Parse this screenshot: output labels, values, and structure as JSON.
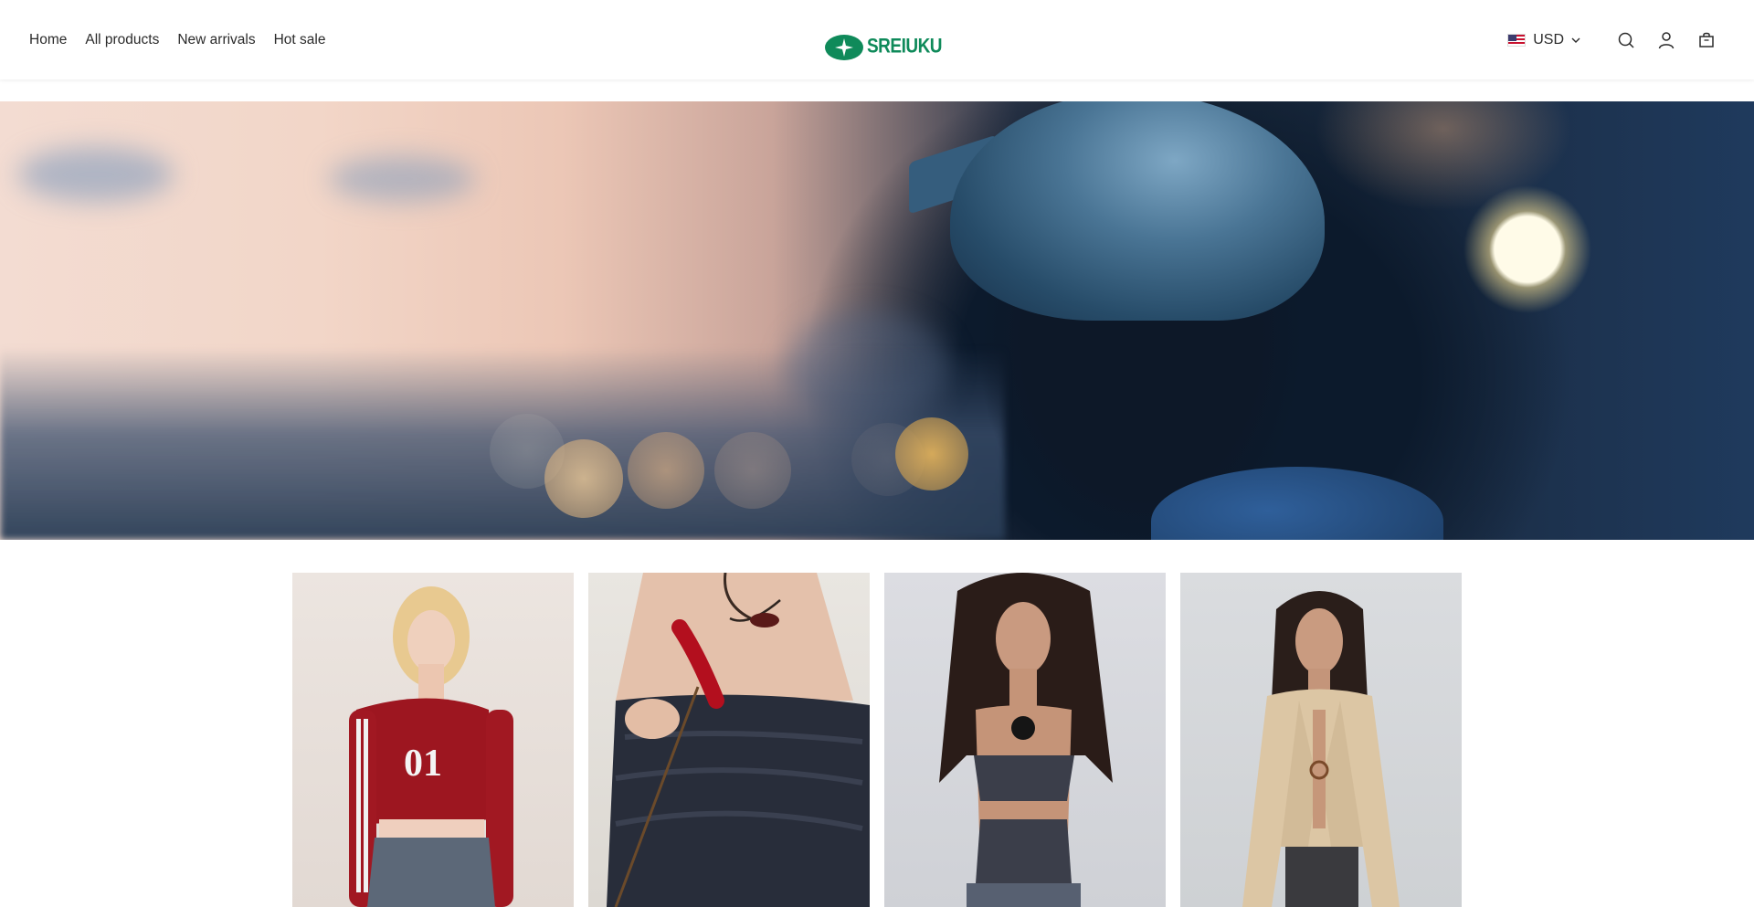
{
  "nav": {
    "items": [
      {
        "label": "Home"
      },
      {
        "label": "All products"
      },
      {
        "label": "New arrivals"
      },
      {
        "label": "Hot sale"
      }
    ]
  },
  "brand": {
    "name": "SREIUKU",
    "logo_icon": "sparkle-oval-logo",
    "color": "#0f8a5a"
  },
  "header_tools": {
    "currency": {
      "flag": "us-flag-icon",
      "label": "USD"
    },
    "icons": [
      "search-icon",
      "account-icon",
      "cart-icon"
    ]
  },
  "hero": {
    "image": "woman-in-helmet-at-sunset-banner"
  },
  "products": [
    {
      "image": "red-off-shoulder-01-crop-top"
    },
    {
      "image": "black-ruffled-tube-top-with-flower"
    },
    {
      "image": "charcoal-ruched-cutout-bandeau-top"
    },
    {
      "image": "beige-knit-ring-cardigan"
    }
  ]
}
